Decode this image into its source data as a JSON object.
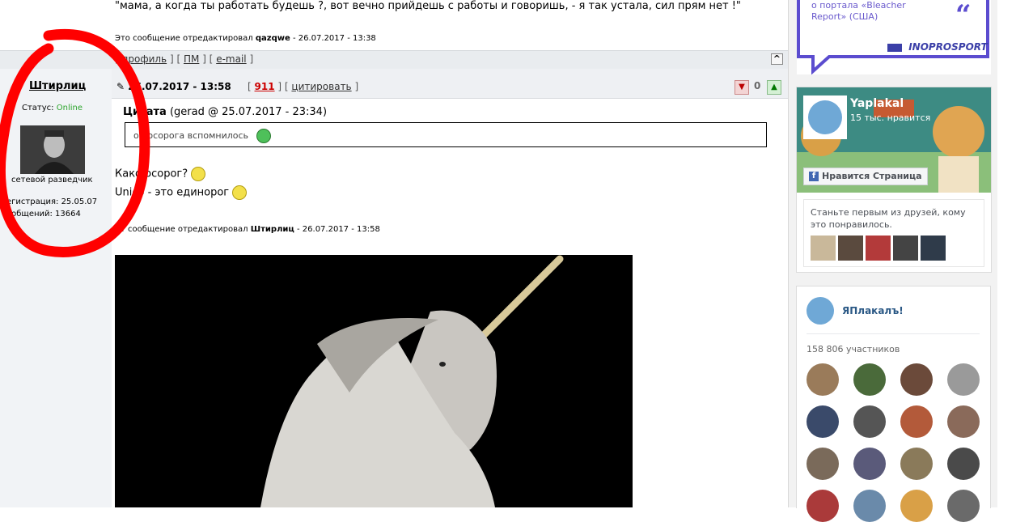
{
  "prev_post": {
    "quote": "\"мама, а когда ты работать будешь ?, вот вечно прийдешь с работы и говоришь, - я так устала, сил прям нет !\"",
    "edit_note_prefix": "Это сообщение отредактировал",
    "edit_user": "qazqwe",
    "edit_date": "- 26.07.2017 - 13:38",
    "links": {
      "bracket_open": "[",
      "bracket_sep": "] [",
      "bracket_close": "]",
      "profile": "профиль",
      "pm": "ПМ",
      "email": "e-mail"
    },
    "up_button": "^"
  },
  "post": {
    "author": "Штирлиц",
    "status_label": "Статус:",
    "status_value": "Online",
    "rank": "сетевой разведчик",
    "registration": "егистрация: 25.05.07",
    "messages": "ообщений: 13664",
    "date": "26.07.2017 - 13:58",
    "num_open": "[",
    "number": "911",
    "num_sep": "] [",
    "quote_link": "цитировать",
    "num_close": "]",
    "rating": "0",
    "quote_title": "Цитата",
    "quote_meta": "(gerad @ 25.07.2017 - 23:34)",
    "quote_text": "о носорога вспомнилось",
    "body_line1": "Како    осорог?",
    "body_line2": "Unico    - это единорог",
    "edit_note_prefix": "Эт     сообщение отредактировал",
    "edit_user": "Штирлиц",
    "edit_date": "- 26.07.2017 - 13:58"
  },
  "ad": {
    "text": "о портала «Bleacher Report» (США)",
    "brand": "INOPROSPORT"
  },
  "facebook": {
    "page_name": "Yaplakal",
    "likes": "15 тыс. нравится",
    "like_button": "Нравится Страница",
    "friends_text": "Станьте первым из друзей, кому это понравилось."
  },
  "vk": {
    "group_name": "ЯПлакалъ!",
    "members": "158 806 участников"
  },
  "colors": {
    "online": "#2da52d",
    "post_number": "#cc0000",
    "ad_accent": "#5b4ccf",
    "fb_blue": "#4267b2",
    "vk_blue": "#2a5885",
    "annotation_red": "#ff0000"
  }
}
